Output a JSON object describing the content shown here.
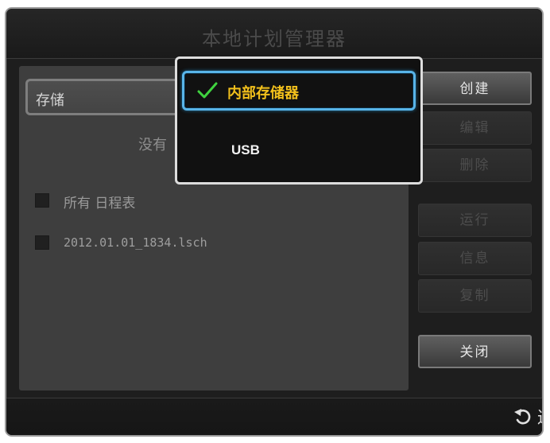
{
  "dialog": {
    "title": "本地计划管理器"
  },
  "storage": {
    "label": "存储",
    "empty_message": "没有"
  },
  "schedules": [
    {
      "label": "所有 日程表",
      "checked": false
    },
    {
      "label": "2012.01.01_1834.lsch",
      "checked": false
    }
  ],
  "buttons": {
    "create": "创建",
    "edit": "编辑",
    "delete": "删除",
    "run": "运行",
    "info": "信息",
    "copy": "复制",
    "close": "关闭"
  },
  "footer": {
    "back_label": "返回",
    "back_icon": "return-arrow-icon"
  },
  "dropdown": {
    "options": [
      {
        "label": "内部存储器",
        "selected": true,
        "icon": "checkmark-icon"
      },
      {
        "label": "USB",
        "selected": false
      }
    ]
  },
  "colors": {
    "selected_text": "#f2c01c",
    "focus_border": "#58b4e8",
    "check": "#3fd23f"
  }
}
